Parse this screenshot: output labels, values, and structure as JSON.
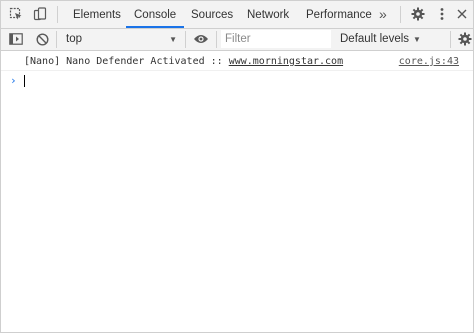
{
  "tabs": [
    {
      "label": "Elements"
    },
    {
      "label": "Console"
    },
    {
      "label": "Sources"
    },
    {
      "label": "Network"
    },
    {
      "label": "Performance"
    }
  ],
  "active_tab": "Console",
  "more_tabs_glyph": "»",
  "toolbar_icons": {
    "inspect": "inspect-element-icon",
    "device": "device-toolbar-icon",
    "settings": "gear-icon",
    "menu": "kebab-menu-icon",
    "close": "close-icon"
  },
  "filterbar": {
    "context": "top",
    "filter_placeholder": "Filter",
    "levels": "Default levels",
    "icons": {
      "sidebar": "sidebar-toggle-icon",
      "clear": "clear-console-icon",
      "live_expression": "eye-icon",
      "settings": "gear-icon"
    }
  },
  "console": {
    "message": {
      "prefix": "[Nano] Nano Defender Activated :: ",
      "link": "www.morningstar.com",
      "source": "core.js:43"
    },
    "prompt_glyph": "›"
  },
  "colors": {
    "accent": "#1a73e8",
    "toolbar_bg": "#f3f3f3",
    "border": "#cfcfcf"
  }
}
